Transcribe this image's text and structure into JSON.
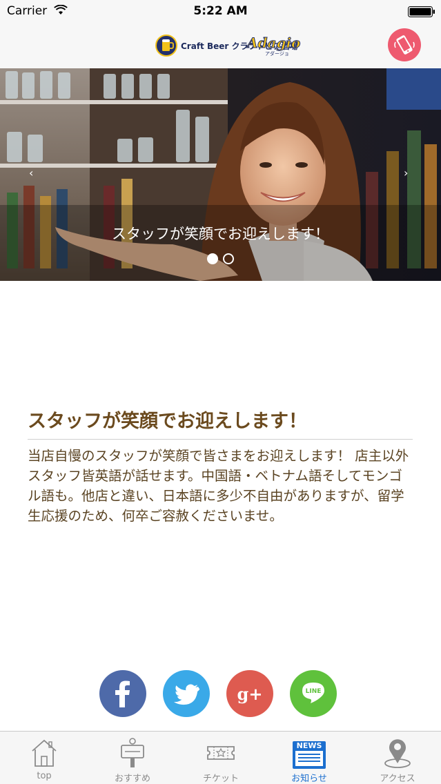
{
  "status_bar": {
    "carrier": "Carrier",
    "time": "5:22 AM"
  },
  "header": {
    "logo_text": "Craft Beer クラフトビア酒場",
    "logo_brand": "Adagio",
    "logo_sub": "アダージョ"
  },
  "hero": {
    "caption": "スタッフが笑顔でお迎えします！",
    "prev": "‹",
    "next": "›",
    "slide_count": 2,
    "active_slide": 1
  },
  "article": {
    "title": "スタッフが笑顔でお迎えします！",
    "body": "当店自慢のスタッフが笑顔で皆さまをお迎えします！ 店主以外スタッフ皆英語が話せます。中国語・ベトナム語そしてモンゴル語も。他店と違い、日本語に多少不自由がありますが、留学生応援のため、何卒ご容赦くださいませ。"
  },
  "share": {
    "facebook_icon": "facebook-icon",
    "twitter_icon": "twitter-icon",
    "googleplus_icon": "google-plus-icon",
    "line_label": "LINE"
  },
  "tabs": [
    {
      "label": "top",
      "icon": "home-icon"
    },
    {
      "label": "おすすめ",
      "icon": "signboard-icon"
    },
    {
      "label": "チケット",
      "icon": "ticket-icon"
    },
    {
      "label": "お知らせ",
      "icon": "news-icon",
      "badge": "NEWS"
    },
    {
      "label": "アクセス",
      "icon": "map-pin-icon"
    }
  ],
  "colors": {
    "accent": "#1c6fcf",
    "title": "#6b4a1e",
    "body": "#5a4322",
    "phone_button": "#ee5a6f",
    "facebook": "#4e6aa9",
    "twitter": "#3aa9e8",
    "google_plus": "#de5b50",
    "line": "#5fc13c"
  }
}
